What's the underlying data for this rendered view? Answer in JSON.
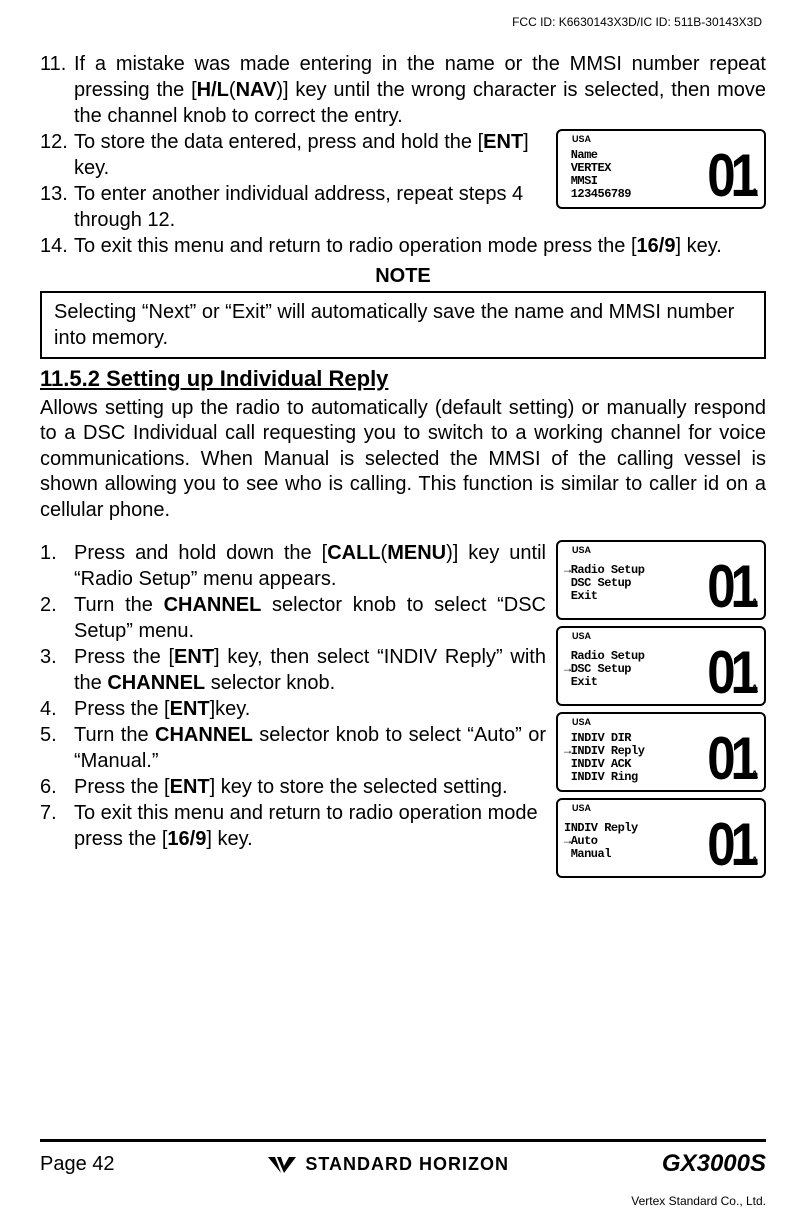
{
  "header": {
    "fccid": "FCC ID: K6630143X3D/IC ID: 511B-30143X3D"
  },
  "steps_top": {
    "s11": {
      "num": "11.",
      "pre": "If a mistake was made entering in the name or the MMSI number repeat pressing the [",
      "key1": "H/L",
      "paren1": "(",
      "key1b": "NAV",
      "post1": ")] key until the wrong character is selected, then move the channel knob to correct the entry."
    },
    "s12": {
      "num": "12.",
      "pre": "To store the data entered, press and hold the [",
      "key": "ENT",
      "post": "] key."
    },
    "s13": {
      "num": "13.",
      "text": "To enter another individual address, repeat steps 4 through 12."
    },
    "s14": {
      "num": "14.",
      "pre": "To exit this menu and return to radio operation mode press the [",
      "key": "16/9",
      "post": "] key."
    }
  },
  "lcd1": {
    "usa": "USA",
    "lines": " Name\n VERTEX\n MMSI\n 123456789",
    "big": "01",
    "suffix": "A"
  },
  "note": {
    "heading": "NOTE",
    "pre": "Selecting “",
    "q1": "Next",
    "mid": "” or “",
    "q2": "Exit",
    "post": "” will automatically save the name and MMSI number into memory."
  },
  "section": {
    "heading": "11.5.2  Setting up Individual Reply",
    "para": "Allows setting up the radio to automatically (default setting) or manually respond to a DSC Individual call requesting you to switch to a working channel for voice communications. When Manual is selected the MMSI of the calling vessel is shown allowing you to see who is calling. This function is similar to caller id on a cellular phone."
  },
  "steps2": {
    "s1": {
      "num": "1.",
      "pre": "Press and hold down the [",
      "key": "CALL",
      "paren": "(",
      "key2": "MENU",
      "post1": ")] key until “",
      "q": "Radio Setup",
      "post2": "” menu appears."
    },
    "s2": {
      "num": "2.",
      "pre": "Turn the ",
      "key": "CHANNEL",
      "post1": " selector knob to select “",
      "q": "DSC Setup",
      "post2": "” menu."
    },
    "s3": {
      "num": "3.",
      "pre": "Press the [",
      "key": "ENT",
      "post1": "] key, then select “",
      "q": "INDIV Reply",
      "post2": "” with the ",
      "key2": "CHANNEL",
      "post3": " selector knob."
    },
    "s4": {
      "num": "4.",
      "pre": "Press the [",
      "key": "ENT",
      "post": "]key."
    },
    "s5": {
      "num": "5.",
      "pre": "Turn the ",
      "key": "CHANNEL",
      "post1": " selector knob to select “",
      "q1": "Auto",
      "mid": "” or “",
      "q2": "Manual",
      "post2": ".”"
    },
    "s6": {
      "num": "6.",
      "pre": "Press the [",
      "key": "ENT",
      "post": "] key to store the selected setting."
    },
    "s7": {
      "num": "7.",
      "pre": "To exit this menu and return to radio operation mode press the [",
      "key": "16/9",
      "post": "] key."
    }
  },
  "lcd2a": {
    "usa": "USA",
    "lines": "→Radio Setup\n DSC Setup\n Exit",
    "big": "01",
    "suffix": "A"
  },
  "lcd2b": {
    "usa": "USA",
    "lines": " Radio Setup\n→DSC Setup\n Exit",
    "big": "01",
    "suffix": "A"
  },
  "lcd2c": {
    "usa": "USA",
    "lines": " INDIV DIR\n→INDIV Reply\n INDIV ACK\n INDIV Ring",
    "big": "01",
    "suffix": "A"
  },
  "lcd2d": {
    "usa": "USA",
    "lines": "INDIV Reply\n→Auto\n Manual",
    "big": "01",
    "suffix": "A"
  },
  "footer": {
    "page": "Page 42",
    "brand": "STANDARD HORIZON",
    "model": "GX3000S",
    "vertex": "Vertex Standard Co., Ltd."
  }
}
